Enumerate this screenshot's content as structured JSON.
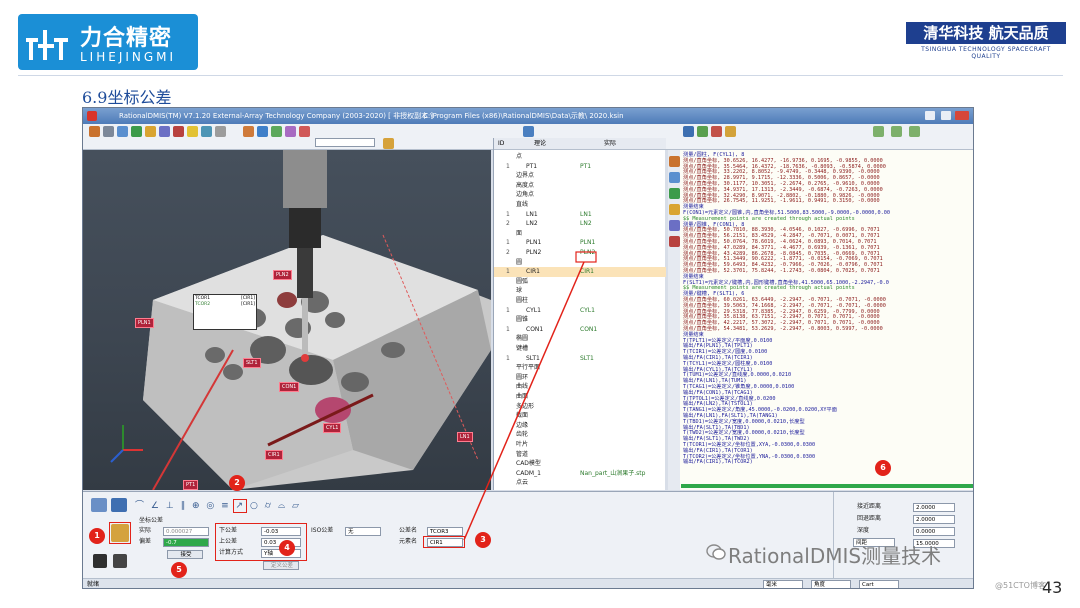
{
  "brand": {
    "logo_cn": "力合精密",
    "logo_en": "LIHEJINGMI",
    "slogan_cn": "清华科技 航天品质",
    "slogan_en": "TSINGHUA TECHNOLOGY SPACECRAFT QUALITY"
  },
  "slide": {
    "title": "6.9坐标公差",
    "page_number": "43",
    "watermark": "RationalDMIS测量技术",
    "watermark_source": "@51CTO博客"
  },
  "app": {
    "title": "RationalDMIS(TM) V7.1.20   External-Array Technology Company (2003-2020) [ 非授权副本 ]",
    "file_path": "C:\\Program Files (x86)\\RationalDMIS\\Data\\示教\\ 2020.ksin",
    "status_left": "就绪"
  },
  "tree": {
    "col_id": "ID",
    "col_theory": "理论",
    "col_actual": "实际",
    "rows": [
      {
        "ix": "",
        "name": "点",
        "actual": ""
      },
      {
        "ix": "1",
        "name": "PT1",
        "actual": "PT1"
      },
      {
        "ix": "",
        "name": "边界点",
        "actual": ""
      },
      {
        "ix": "",
        "name": "高度点",
        "actual": ""
      },
      {
        "ix": "",
        "name": "边角点",
        "actual": ""
      },
      {
        "ix": "",
        "name": "直线",
        "actual": ""
      },
      {
        "ix": "1",
        "name": "LN1",
        "actual": "LN1"
      },
      {
        "ix": "2",
        "name": "LN2",
        "actual": "LN2"
      },
      {
        "ix": "",
        "name": "面",
        "actual": ""
      },
      {
        "ix": "1",
        "name": "PLN1",
        "actual": "PLN1"
      },
      {
        "ix": "2",
        "name": "PLN2",
        "actual": "PLN2"
      },
      {
        "ix": "",
        "name": "圆",
        "actual": ""
      },
      {
        "ix": "1",
        "name": "CIR1",
        "actual": "CIR1"
      },
      {
        "ix": "",
        "name": "圆弧",
        "actual": ""
      },
      {
        "ix": "",
        "name": "球",
        "actual": ""
      },
      {
        "ix": "",
        "name": "圆柱",
        "actual": ""
      },
      {
        "ix": "1",
        "name": "CYL1",
        "actual": "CYL1"
      },
      {
        "ix": "",
        "name": "圆锥",
        "actual": ""
      },
      {
        "ix": "1",
        "name": "CON1",
        "actual": "CON1"
      },
      {
        "ix": "",
        "name": "椭圆",
        "actual": ""
      },
      {
        "ix": "",
        "name": "键槽",
        "actual": ""
      },
      {
        "ix": "1",
        "name": "SLT1",
        "actual": "SLT1"
      },
      {
        "ix": "",
        "name": "平行平面",
        "actual": ""
      },
      {
        "ix": "",
        "name": "圆环",
        "actual": ""
      },
      {
        "ix": "",
        "name": "曲线",
        "actual": ""
      },
      {
        "ix": "",
        "name": "曲面",
        "actual": ""
      },
      {
        "ix": "",
        "name": "多边形",
        "actual": ""
      },
      {
        "ix": "",
        "name": "截面",
        "actual": ""
      },
      {
        "ix": "",
        "name": "边缘",
        "actual": ""
      },
      {
        "ix": "",
        "name": "齿轮",
        "actual": ""
      },
      {
        "ix": "",
        "name": "叶片",
        "actual": ""
      },
      {
        "ix": "",
        "name": "管道",
        "actual": ""
      },
      {
        "ix": "",
        "name": "CAD模型",
        "actual": ""
      },
      {
        "ix": "",
        "name": "CADM_1",
        "actual": "Nan_part_山涧果子.stp"
      },
      {
        "ix": "",
        "name": "点云",
        "actual": ""
      }
    ]
  },
  "code_lines": [
    {
      "n": "63",
      "t": "测量/圆柱, F(CYL1), 8",
      "c": "#1a1a9a"
    },
    {
      "n": "64",
      "t": "  测点/直角坐标, 30.6526, 16.4277, -16.9736, 0.1695, -0.9855, 0.0000",
      "c": "#8a1a1a"
    },
    {
      "n": "65",
      "t": "  测点/直角坐标, 35.5464, 16.4372, -18.7636, -0.8093, -0.5874, 0.0000",
      "c": "#8a1a1a"
    },
    {
      "n": "66",
      "t": "  测点/直角坐标, 33.2202, 8.8052, -9.4749, -0.3448, 0.9390, -0.0000",
      "c": "#8a1a1a"
    },
    {
      "n": "67",
      "t": "  测点/直角坐标, 28.9971, 9.1715, -12.3336, 0.5006, 0.8657, -0.0000",
      "c": "#8a1a1a"
    },
    {
      "n": "68",
      "t": "  测点/直角坐标, 30.1177, 10.3051, -2.2674, 0.2765, -0.9610, 0.0000",
      "c": "#8a1a1a"
    },
    {
      "n": "69",
      "t": "  测点/直角坐标, 34.9371, 17.1313, -2.3449, -0.6874, -0.7263, 0.0000",
      "c": "#8a1a1a"
    },
    {
      "n": "70",
      "t": "  测点/直角坐标, 32.4290, 8.9071, -2.8802, -0.1880, 0.9826, -0.0000",
      "c": "#8a1a1a"
    },
    {
      "n": "71",
      "t": "  测点/直角坐标, 26.7545, 11.9251, -1.9611, 0.9491, 0.3150, -0.0000",
      "c": "#8a1a1a"
    },
    {
      "n": "72",
      "t": "测量结束",
      "c": "#1a1a9a"
    },
    {
      "n": "73",
      "t": "F(CON1)=元素定义/圆锥,内,直角坐标,51.5000,83.5000,-9.0000,-0.0000,0.00",
      "c": "#1a1a9a"
    },
    {
      "n": "74",
      "t": "$$ Measurement points are created through actual points",
      "c": "#2b8a2b"
    },
    {
      "n": "75",
      "t": "测量/圆锥, F(CON1), 8",
      "c": "#1a1a9a"
    },
    {
      "n": "76",
      "t": "  测点/直角坐标, 50.7810, 88.3930, -4.0546, 0.1027, -0.6996, 0.7071",
      "c": "#8a1a1a"
    },
    {
      "n": "77",
      "t": "  测点/直角坐标, 56.2151, 83.4529, -4.2847, -0.7071, 0.0071, 0.7071",
      "c": "#8a1a1a"
    },
    {
      "n": "78",
      "t": "  测点/直角坐标, 50.0764, 78.6019, -4.0624, 0.0893, 0.7014, 0.7071",
      "c": "#8a1a1a"
    },
    {
      "n": "79",
      "t": "  测点/直角坐标, 47.0289, 84.3771, -4.4677, 0.6939, -0.1361, 0.7071",
      "c": "#8a1a1a"
    },
    {
      "n": "80",
      "t": "  测点/直角坐标, 43.4289, 86.2678, -8.0845, 0.7035, -0.0669, 0.7071",
      "c": "#8a1a1a"
    },
    {
      "n": "81",
      "t": "  测点/直角坐标, 51.3449, 90.6222, -1.8771, -0.0154, -0.7069, 0.7071",
      "c": "#8a1a1a"
    },
    {
      "n": "82",
      "t": "  测点/直角坐标, 59.6493, 84.4232, -0.7966, -0.7026, -0.0796, 0.7071",
      "c": "#8a1a1a"
    },
    {
      "n": "83",
      "t": "  测点/直角坐标, 52.3701, 75.8244, -1.2743, -0.0804, 0.7025, 0.7071",
      "c": "#8a1a1a"
    },
    {
      "n": "84",
      "t": "测量结束",
      "c": "#1a1a9a"
    },
    {
      "n": "85",
      "t": "F(SLT1)=元素定义/键槽,内,圆形键槽,直角坐标,41.5000,65.1000,-2.2947,-0.0",
      "c": "#1a1a9a"
    },
    {
      "n": "86",
      "t": "$$ Measurement points are created through actual points",
      "c": "#2b8a2b"
    },
    {
      "n": "87",
      "t": "测量/键槽, F(SLT1), 6",
      "c": "#1a1a9a"
    },
    {
      "n": "88",
      "t": "  测点/直角坐标, 60.0261, 63.6449, -2.2947, -0.7071, -0.7071, -0.0000",
      "c": "#8a1a1a"
    },
    {
      "n": "89",
      "t": "  测点/直角坐标, 39.5063, 74.1668, -2.2947, -0.7071, -0.7071, -0.0000",
      "c": "#8a1a1a"
    },
    {
      "n": "90",
      "t": "  测点/直角坐标, 29.5318, 77.8385, -2.2947, 0.6259, -0.7799, 0.0000",
      "c": "#8a1a1a"
    },
    {
      "n": "91",
      "t": "  测点/直角坐标, 35.8138, 63.7151, -2.2947, 0.7071, 0.7071, -0.0000",
      "c": "#8a1a1a"
    },
    {
      "n": "92",
      "t": "  测点/直角坐标, 42.2217, 57.3072, -2.2947, 0.7071, 0.7071, -0.0000",
      "c": "#8a1a1a"
    },
    {
      "n": "93",
      "t": "  测点/直角坐标, 54.3481, 53.2629, -2.2947, -0.8003, 0.5997, -0.0000",
      "c": "#8a1a1a"
    },
    {
      "n": "94",
      "t": "测量结束",
      "c": "#1a1a9a"
    },
    {
      "n": "95",
      "t": "T(TPLT1)=公差定义/平面度,0.0100",
      "c": "#1a1a9a"
    },
    {
      "n": "96",
      "t": "输出/FA(PLN1),TA(TPLT1)",
      "c": "#1a1a9a"
    },
    {
      "n": "97",
      "t": "T(TCIR1)=公差定义/圆度,0.0100",
      "c": "#1a1a9a"
    },
    {
      "n": "98",
      "t": "输出/FA(CIR1),TA(TCIR1)",
      "c": "#1a1a9a"
    },
    {
      "n": "99",
      "t": "T(TCYL1)=公差定义/圆柱度,0.0100",
      "c": "#1a1a9a"
    },
    {
      "n": "100",
      "t": "输出/FA(CYL1),TA(TCYL1)",
      "c": "#1a1a9a"
    },
    {
      "n": "101",
      "t": "T(TUM1)=公差定义/直线度,0.0000,0.0210",
      "c": "#1a1a9a"
    },
    {
      "n": "102",
      "t": "输出/FA(LN1),TA(TUM1)",
      "c": "#1a1a9a"
    },
    {
      "n": "103",
      "t": "T(TCAG1)=公差定义/锥角度,0.0000,0.0100",
      "c": "#1a1a9a"
    },
    {
      "n": "104",
      "t": "输出/FA(CON1),TA(TCAG1)",
      "c": "#1a1a9a"
    },
    {
      "n": "105",
      "t": "T(TPTOL1)=公差定义/直线度,0.0200",
      "c": "#1a1a9a"
    },
    {
      "n": "106",
      "t": "输出/FA(LN2),TA(TSTOL1)",
      "c": "#1a1a9a"
    },
    {
      "n": "107",
      "t": "T(TANG1)=公差定义/角度,45.0000,-0.0200,0.0200,XY平面",
      "c": "#1a1a9a"
    },
    {
      "n": "108",
      "t": "输出/FA(LN1),FA(SLT1),TA(TANG1)",
      "c": "#1a1a9a"
    },
    {
      "n": "109",
      "t": "T(TBD1)=公差定义/宽度,0.0000,0.0210,长度型",
      "c": "#1a1a9a"
    },
    {
      "n": "110",
      "t": "输出/FA(SLT1),TA(TBD1)",
      "c": "#1a1a9a"
    },
    {
      "n": "111",
      "t": "T(TWD2)=公差定义/宽度,0.0000,0.0210,长度型",
      "c": "#1a1a9a"
    },
    {
      "n": "112",
      "t": "输出/FA(SLT1),TA(TWD2)",
      "c": "#1a1a9a"
    },
    {
      "n": "113",
      "t": "T(TCOR1)=公差定义/坐标位置,XYA,-0.0300,0.0300",
      "c": "#1a1a9a"
    },
    {
      "n": "114",
      "t": "输出/FA(CIR1),TA(TCOR1)",
      "c": "#1a1a9a"
    },
    {
      "n": "115",
      "t": "T(TCOR2)=公差定义/坐标位置,YNA,-0.0300,0.0300",
      "c": "#1a1a9a"
    },
    {
      "n": "116",
      "t": "输出/FA(CIR1),TA(TCOR2)",
      "c": "#1a1a9a"
    }
  ],
  "tol_panel": {
    "group_label": "坐标公差",
    "actual_label": "实际",
    "actual_value": "0.000027",
    "deviation_label": "偏差",
    "deviation_value": "-0.7",
    "button_label": "接受",
    "lower_label": "下公差",
    "lower_value": "-0.03",
    "upper_label": "上公差",
    "upper_value": "0.03",
    "calc_label": "计算方式",
    "calc_value": "Y轴",
    "iso_label": "ISO公差",
    "iso_value": "无",
    "define_button": "定义公差",
    "tol_name_label": "公差名",
    "tol_name_value": "TCOR3",
    "elem_name_label": "元素名",
    "elem_name_value": "CIR1"
  },
  "right_panel": {
    "rows": [
      {
        "label": "接近距离",
        "value": "2.0000"
      },
      {
        "label": "回退距离",
        "value": "2.0000"
      },
      {
        "label": "深度",
        "value": "0.0000"
      },
      {
        "label": "间距",
        "value": "15.0000"
      }
    ],
    "dropdown": "间距"
  },
  "status_dropdowns": [
    "毫米",
    "角度",
    "Cart"
  ],
  "viewport_labels": [
    "PLN1",
    "PLN2",
    "SLT1",
    "CON1",
    "CIR1",
    "CYL1",
    "LN1",
    "PT1"
  ],
  "callout": {
    "title": "TCOR1",
    "elem": "[CIR1]",
    "line1": "TCOR2",
    "elem2": "[CIR1]"
  },
  "badges": [
    "1",
    "2",
    "3",
    "4",
    "5",
    "6"
  ],
  "colors": {
    "accent_red": "#e2231a",
    "brand_blue": "#1b8fd6",
    "navy": "#1e3f8f"
  }
}
